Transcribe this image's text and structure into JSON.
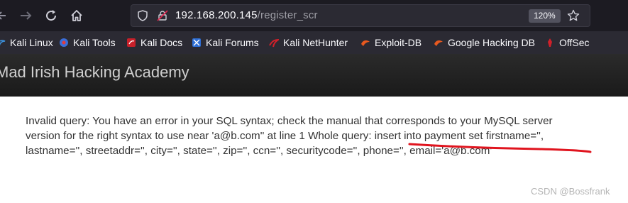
{
  "browser": {
    "url_host": "192.168.200.145",
    "url_path": "/register_scr",
    "zoom": "120%"
  },
  "bookmarks": [
    {
      "label": "Kali Linux",
      "icon": "kali-dragon-icon"
    },
    {
      "label": "Kali Tools",
      "icon": "kali-tools-icon"
    },
    {
      "label": "Kali Docs",
      "icon": "kali-docs-icon"
    },
    {
      "label": "Kali Forums",
      "icon": "kali-forums-icon"
    },
    {
      "label": "Kali NetHunter",
      "icon": "kali-nethunter-icon"
    },
    {
      "label": "Exploit-DB",
      "icon": "exploit-db-icon"
    },
    {
      "label": "Google Hacking DB",
      "icon": "ghdb-icon"
    },
    {
      "label": "OffSec",
      "icon": "offsec-icon"
    }
  ],
  "site": {
    "title": "Mad Irish Hacking Academy"
  },
  "error": {
    "line1": "Invalid query: You have an error in your SQL syntax; check the manual that corresponds to your MySQL server",
    "line2": "version for the right syntax to use near 'a@b.com'' at line 1 Whole query: insert into payment set firstname='',",
    "line3": "lastname='', streetaddr='', city='', state='', zip='', ccn='', securitycode='', phone='', email='a@b.com'"
  },
  "annotation_color": "#e0141e",
  "watermark": "CSDN @Bossfrank"
}
